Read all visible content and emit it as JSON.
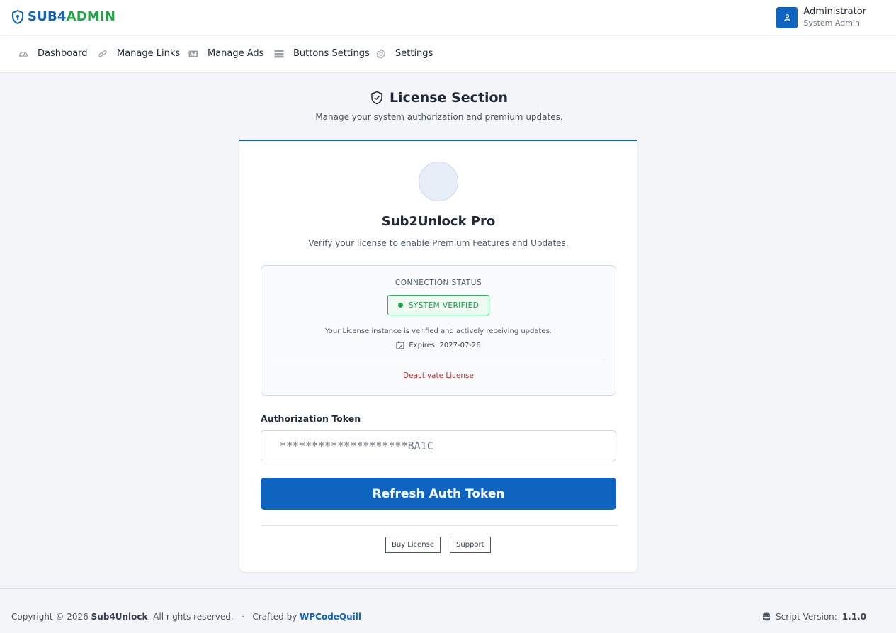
{
  "brand": {
    "part1": "SUB4",
    "part2": "ADMIN"
  },
  "user": {
    "name": "Administrator",
    "role": "System Admin"
  },
  "nav": [
    {
      "label": "Dashboard",
      "icon": "gauge-icon"
    },
    {
      "label": "Manage Links",
      "icon": "link-icon"
    },
    {
      "label": "Manage Ads",
      "icon": "ad-icon"
    },
    {
      "label": "Buttons Settings",
      "icon": "list-icon"
    },
    {
      "label": "Settings",
      "icon": "gear-icon"
    }
  ],
  "section": {
    "title": "License Section",
    "subtitle": "Manage your system authorization and premium updates."
  },
  "card": {
    "product_name": "Sub2Unlock Pro",
    "product_desc": "Verify your license to enable Premium Features and Updates.",
    "status": {
      "label": "CONNECTION STATUS",
      "badge": "SYSTEM VERIFIED",
      "message": "Your License instance is verified and actively receiving updates.",
      "expires": "Expires: 2027-07-26",
      "deactivate": "Deactivate License"
    },
    "token": {
      "label": "Authorization Token",
      "value": "********************BA1C"
    },
    "refresh_label": "Refresh Auth Token",
    "buy_label": "Buy License",
    "support_label": "Support"
  },
  "footer": {
    "copyright": "Copyright © 2026",
    "company": "Sub4Unlock",
    "rights": ". All rights reserved.",
    "sep": "·",
    "crafted": "Crafted by",
    "author": "WPCodeQuill",
    "version_label": "Script Version:",
    "version": "1.1.0"
  },
  "colors": {
    "primary": "#0f64c0",
    "accent": "#22a447",
    "danger": "#d12c2c"
  }
}
